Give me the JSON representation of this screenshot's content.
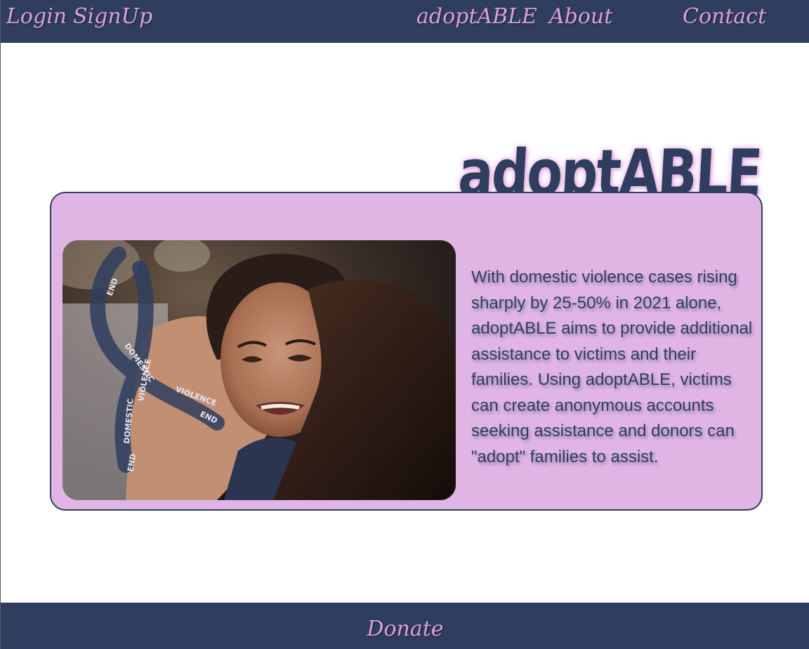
{
  "nav": {
    "login": "Login",
    "signup": "SignUp",
    "home": "adoptABLE",
    "about": "About",
    "contact": "Contact"
  },
  "hero": {
    "title": "adoptABLE"
  },
  "card": {
    "image_icon": "photo-ribbon-image",
    "ribbon_words": [
      "END",
      "DOMESTIC",
      "VIOLENCE"
    ],
    "description": "With domestic violence cases rising sharply by 25-50% in 2021 alone, adoptABLE aims to provide additional assistance to victims and their families. Using adoptABLE, victims can create anonymous accounts seeking assistance and donors can \"adopt\" families to assist."
  },
  "footer": {
    "donate": "Donate"
  },
  "colors": {
    "navy": "#2f3e5e",
    "pink": "#dba0d8",
    "lilac": "#e0b5e4",
    "white": "#ffffff"
  }
}
